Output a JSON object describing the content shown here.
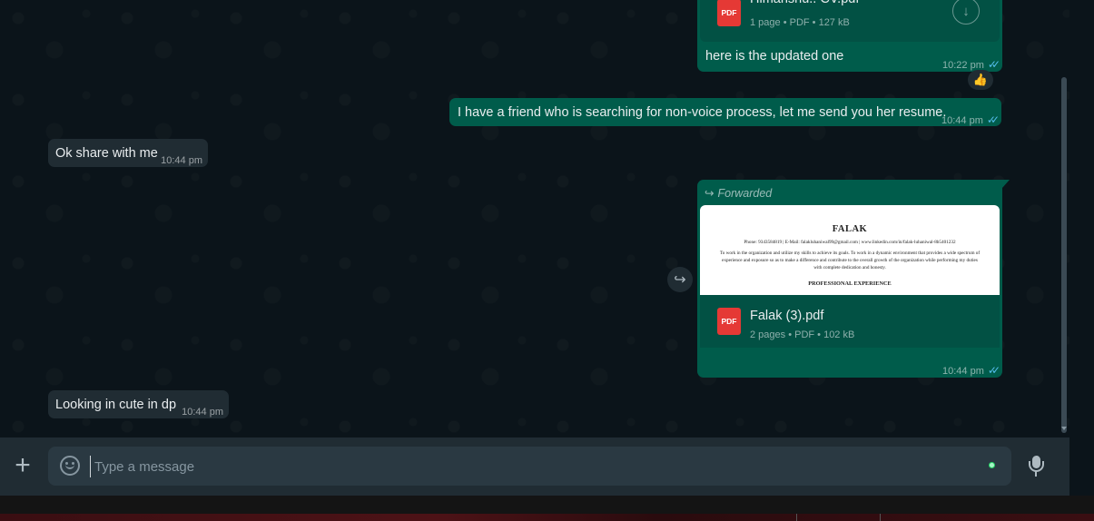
{
  "colors": {
    "chat_bg": "#0b141a",
    "outgoing_bubble": "#005c4b",
    "incoming_bubble": "#202c33",
    "composer_bg": "#202c33",
    "input_bg": "#2a3942",
    "read_ticks": "#53bdeb",
    "pdf_badge": "#e53935"
  },
  "icons": {
    "pdf": "PDF",
    "double_tick": "✓✓",
    "forward": "↪",
    "thumbs_up": "👍",
    "plus": "+",
    "emoji": "☺",
    "mic": "mic-icon",
    "download": "↓"
  },
  "messages": [
    {
      "id": "m1",
      "direction": "outgoing",
      "doc": {
        "name": "Himanshu.. CV.pdf",
        "info": "1 page • PDF • 127 kB"
      },
      "text": "here is the updated one",
      "time": "10:22 pm",
      "reaction": "👍"
    },
    {
      "id": "m2",
      "direction": "outgoing",
      "text": "I have a friend who is searching for non-voice process, let me send you her resume.",
      "time": "10:44 pm"
    },
    {
      "id": "m3",
      "direction": "incoming",
      "text": "Ok share with me",
      "time": "10:44 pm"
    },
    {
      "id": "m4",
      "direction": "outgoing",
      "forwarded_label": "Forwarded",
      "preview": {
        "name": "FALAK",
        "contact": "Phone: 9343584819 | E-Mail: falakluhaniwal99@gmail.com | www.linkedin.com/in/falak-luhaniwal-8b5401232",
        "objective": "To work in the organization and utilize my skills to achieve its goals. To work in a dynamic environment that provides a wide spectrum of experience and exposure so as to make a difference and contribute to the overall growth of the organization while performing my duties with complete dedication and honesty.",
        "section": "PROFESSIONAL EXPERIENCE"
      },
      "doc": {
        "name": "Falak (3).pdf",
        "info": "2 pages • PDF • 102 kB"
      },
      "time": "10:44 pm"
    },
    {
      "id": "m5",
      "direction": "incoming",
      "text": "Looking in cute in dp",
      "time": "10:44 pm"
    }
  ],
  "composer": {
    "placeholder": "Type a message"
  }
}
